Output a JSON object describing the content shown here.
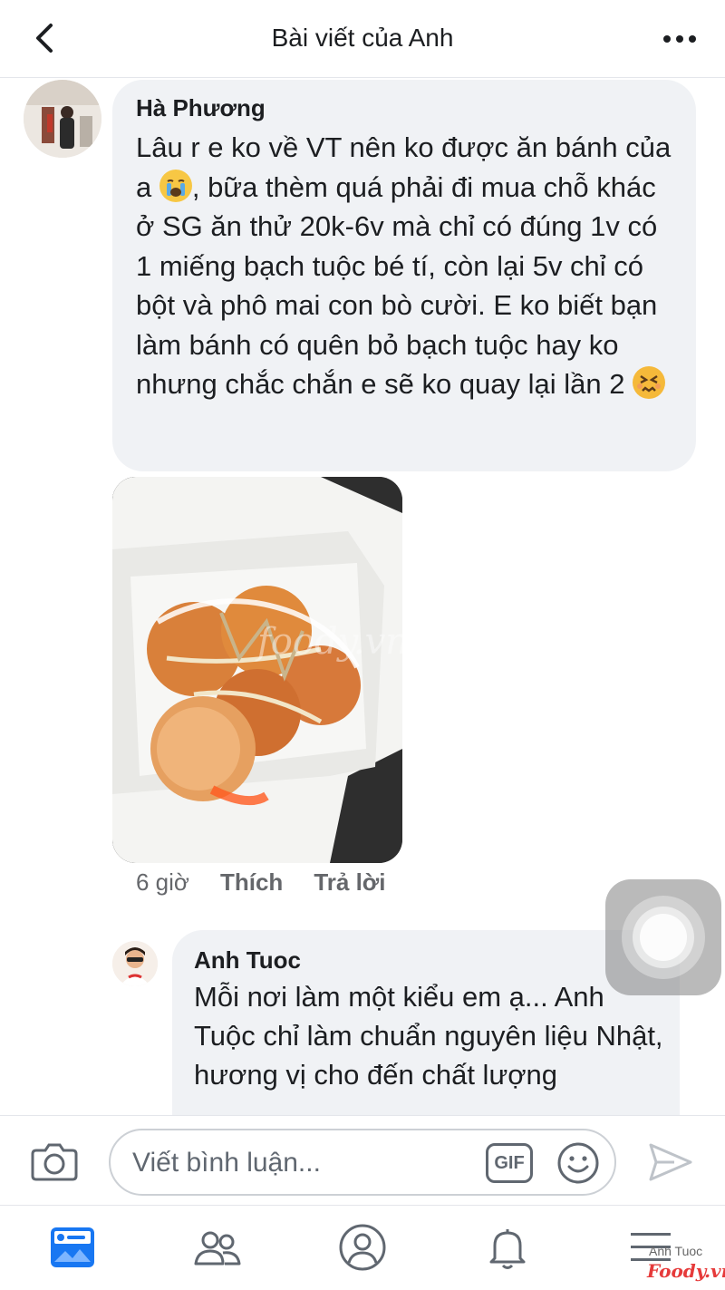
{
  "header": {
    "title": "Bài viết của Anh",
    "back_icon": "chevron-left-icon",
    "more_icon": "more-horizontal-icon"
  },
  "comments": [
    {
      "author": "Hà Phương",
      "text_before_emoji": "Lâu r e ko về VT nên ko được ăn bánh của a ",
      "emoji_1": "loudly-crying-face",
      "text_middle": ", bữa thèm quá phải đi mua chỗ khác ở SG ăn thử 20k-6v mà chỉ có đúng 1v có 1 miếng bạch tuộc bé tí, còn lại 5v chỉ có bột và phô mai con bò cười. E ko biết bạn làm bánh có quên bỏ bạch tuộc hay ko nhưng chắc chắn e sẽ ko quay lại lần 2 ",
      "emoji_2": "confounded-face",
      "photo_watermark": "foody.vn",
      "time": "6 giờ",
      "like_label": "Thích",
      "reply_label": "Trả lời"
    },
    {
      "author": "Anh Tuoc",
      "text": "Mỗi nơi làm một kiểu em ạ... Anh Tuộc chỉ làm chuẩn nguyên liệu Nhật, hương vị cho đến chất lượng"
    }
  ],
  "composer": {
    "placeholder": "Viết bình luận...",
    "gif_label": "GIF",
    "camera_icon": "camera-icon",
    "emoji_icon": "smiley-icon",
    "send_icon": "send-icon"
  },
  "bottom_nav": {
    "items": [
      "news-feed-icon",
      "friends-icon",
      "profile-icon",
      "bell-icon",
      "menu-icon"
    ],
    "active_color": "#1877f2"
  },
  "watermark": {
    "line1": "Anh Tuoc",
    "line2": "Foody.vn"
  }
}
